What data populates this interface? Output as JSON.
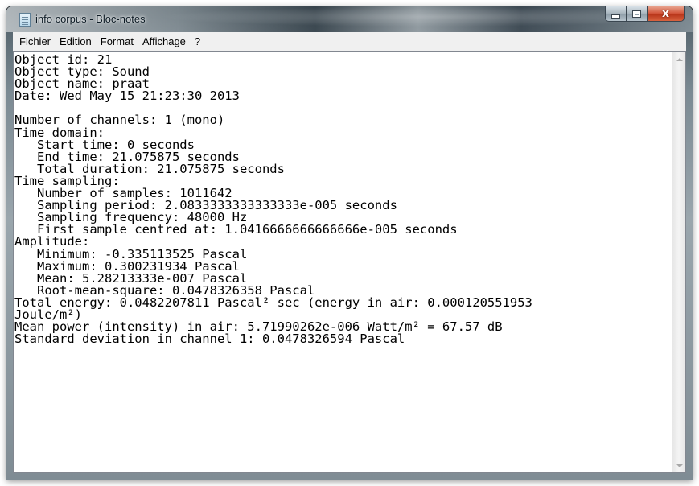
{
  "window": {
    "title": "info corpus - Bloc-notes"
  },
  "caption_buttons": {
    "close_glyph": "x"
  },
  "menu": {
    "items": [
      "Fichier",
      "Edition",
      "Format",
      "Affichage",
      "?"
    ]
  },
  "document": {
    "lines": [
      "Object id: 21",
      "Object type: Sound",
      "Object name: praat",
      "Date: Wed May 15 21:23:30 2013",
      "",
      "Number of channels: 1 (mono)",
      "Time domain:",
      "   Start time: 0 seconds",
      "   End time: 21.075875 seconds",
      "   Total duration: 21.075875 seconds",
      "Time sampling:",
      "   Number of samples: 1011642",
      "   Sampling period: 2.0833333333333333e-005 seconds",
      "   Sampling frequency: 48000 Hz",
      "   First sample centred at: 1.0416666666666666e-005 seconds",
      "Amplitude:",
      "   Minimum: -0.335113525 Pascal",
      "   Maximum: 0.300231934 Pascal",
      "   Mean: 5.28213333e-007 Pascal",
      "   Root-mean-square: 0.0478326358 Pascal",
      "Total energy: 0.0482207811 Pascal² sec (energy in air: 0.000120551953",
      "Joule/m²)",
      "Mean power (intensity) in air: 5.71990262e-006 Watt/m² = 67.57 dB",
      "Standard deviation in channel 1: 0.0478326594 Pascal"
    ]
  },
  "icons": {
    "app": "notepad-icon",
    "minimize": "minimize-icon",
    "maximize": "maximize-icon",
    "close": "close-icon",
    "scroll_up": "arrow-up-icon",
    "scroll_down": "arrow-down-icon"
  }
}
